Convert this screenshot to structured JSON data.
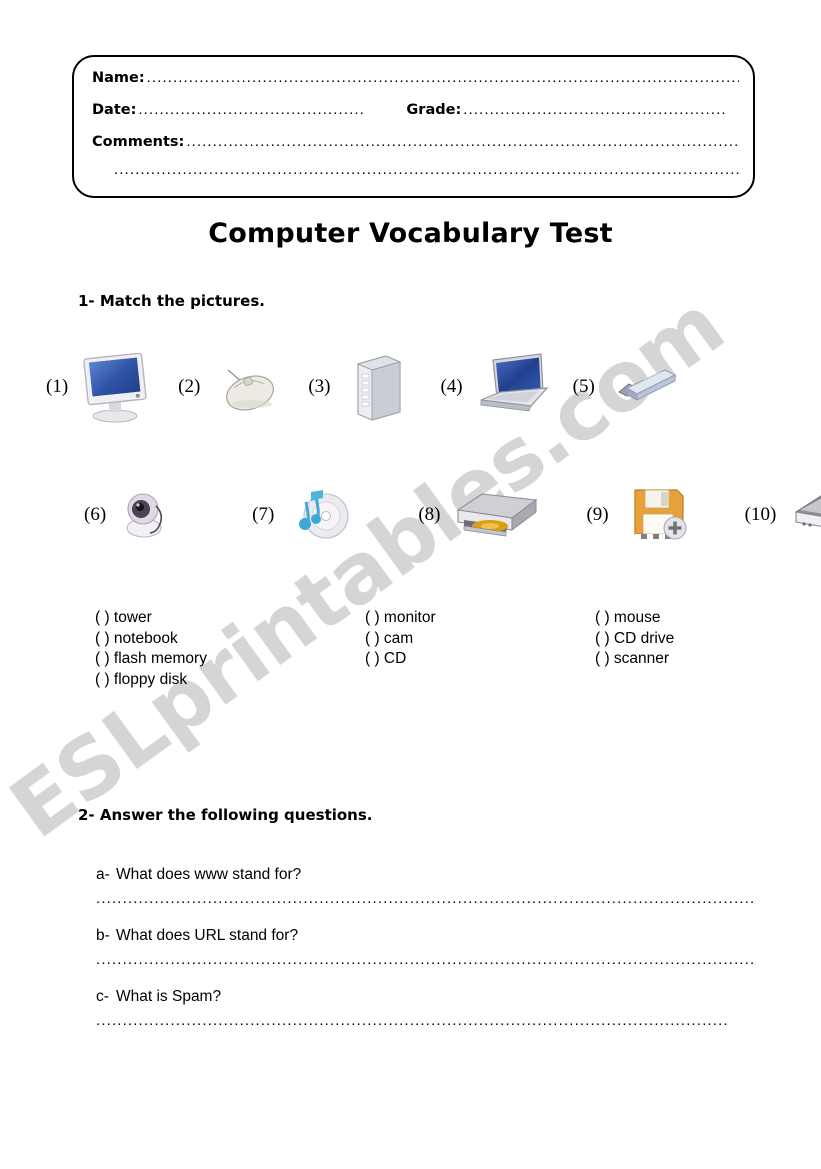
{
  "document": {
    "title": "Computer Vocabulary Test",
    "watermark": "ESLprintables.com"
  },
  "header_box": {
    "name_label": "Name:",
    "date_label": "Date:",
    "grade_label": "Grade:",
    "comments_label": "Comments:",
    "name_dots": "...........................................................................................................................",
    "date_dots": ".............................................",
    "grade_dots": "..................................................",
    "comments_dots": "...............................................................................................................",
    "extra_dots": "..........................................................................................................................."
  },
  "sections": [
    {
      "heading": "1- Match the pictures.",
      "pictures_row_1": [
        {
          "number": "(1)",
          "icon": "monitor-icon"
        },
        {
          "number": "(2)",
          "icon": "mouse-icon"
        },
        {
          "number": "(3)",
          "icon": "tower-icon"
        },
        {
          "number": "(4)",
          "icon": "notebook-icon"
        },
        {
          "number": "(5)",
          "icon": "flash-memory-icon"
        }
      ],
      "pictures_row_2": [
        {
          "number": "(6)",
          "icon": "webcam-icon"
        },
        {
          "number": "(7)",
          "icon": "cd-icon"
        },
        {
          "number": "(8)",
          "icon": "cd-drive-icon"
        },
        {
          "number": "(9)",
          "icon": "floppy-disk-icon"
        },
        {
          "number": "(10)",
          "icon": "scanner-icon"
        }
      ],
      "word_columns": [
        [
          "(   ) tower",
          "(   ) notebook",
          "(   ) flash memory",
          "(   ) floppy disk"
        ],
        [
          "(   ) monitor",
          "(   ) cam",
          "(   ) CD"
        ],
        [
          "(   ) mouse",
          "(   ) CD drive",
          "(   ) scanner"
        ]
      ]
    },
    {
      "heading": "2- Answer the following questions.",
      "questions": [
        {
          "letter": "a-",
          "text": "What does www stand for?",
          "answer_dots": "......................................................................................................................................"
        },
        {
          "letter": "b-",
          "text": "What does URL stand for?",
          "answer_dots": "......................................................................................................................................"
        },
        {
          "letter": "c-",
          "text": "What is Spam?",
          "answer_dots": "..............................................................................................................................."
        }
      ]
    }
  ],
  "colors": {
    "ink": "#000000",
    "watermark": "#d5d5d5",
    "screen_blue": "#2c4d9e",
    "floppy_orange": "#e8a13a"
  }
}
